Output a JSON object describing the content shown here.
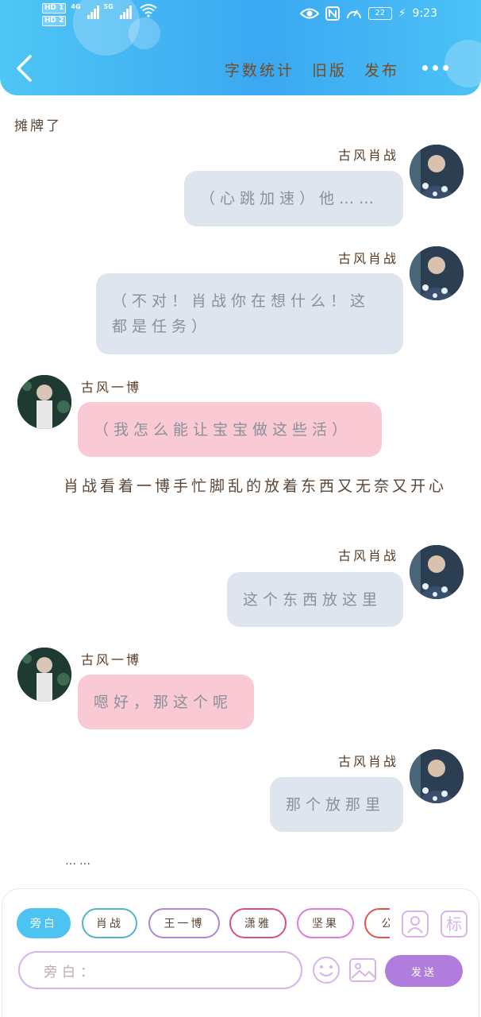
{
  "status_bar": {
    "sim1": "HD 1",
    "sim2": "HD 2",
    "network1": "4G",
    "network2": "5G",
    "battery": "22",
    "time": "9:23"
  },
  "header": {
    "nav_links": [
      "字数统计",
      "旧版",
      "发布"
    ]
  },
  "chat": {
    "top_partial_text": "摊牌了",
    "messages": [
      {
        "sender": "古风肖战",
        "text": "（心跳加速）他……"
      },
      {
        "sender": "古风肖战",
        "text": "（不对！肖战你在想什么！这都是任务）"
      },
      {
        "sender": "古风一博",
        "text": "（我怎么能让宝宝做这些活）"
      },
      {
        "narration": "肖战看着一博手忙脚乱的放着东西又无奈又开心"
      },
      {
        "sender": "古风肖战",
        "text": "这个东西放这里"
      },
      {
        "sender": "古风一博",
        "text": "嗯好，那这个呢"
      },
      {
        "sender": "古风肖战",
        "text": "那个放那里"
      },
      {
        "narration": "……"
      }
    ]
  },
  "input_bar": {
    "chips": [
      "旁白",
      "肖战",
      "王一博",
      "潇雅",
      "坚果",
      "公"
    ],
    "placeholder": "旁白：",
    "send_label": "发送",
    "tag_icon_label": "标"
  },
  "colors": {
    "header_blue": "#3aa8f2",
    "right_bubble": "#dfe5ee",
    "left_bubble": "#f9c9d4",
    "send_purple": "#b07ddc",
    "chip_active": "#4dc3f2"
  }
}
